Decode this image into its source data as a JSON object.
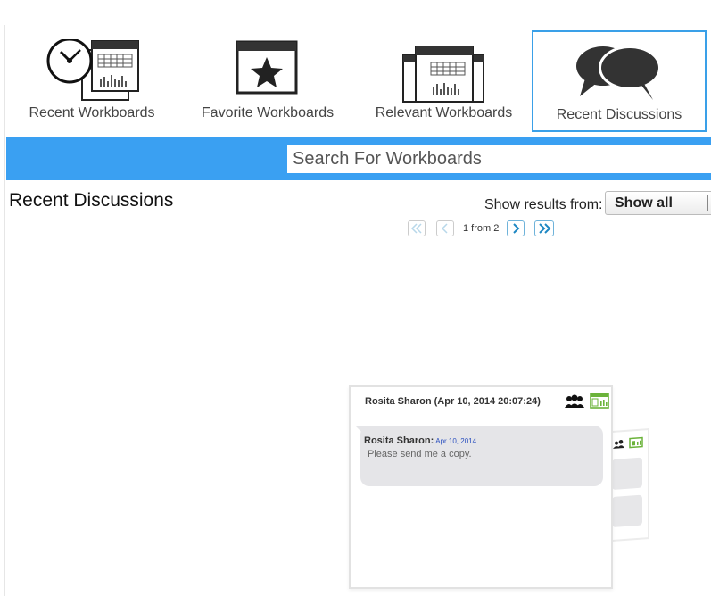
{
  "tabs": [
    {
      "label": "Recent Workboards",
      "icon": "clock-workboard-icon"
    },
    {
      "label": "Favorite Workboards",
      "icon": "star-workboard-icon"
    },
    {
      "label": "Relevant Workboards",
      "icon": "stacked-workboards-icon"
    },
    {
      "label": "Recent Discussions",
      "icon": "speech-bubbles-icon",
      "active": true
    }
  ],
  "search": {
    "placeholder": "Search For Workboards",
    "value": ""
  },
  "section": {
    "title": "Recent Discussions"
  },
  "filter": {
    "label": "Show results from:",
    "selected": "Show all"
  },
  "pager": {
    "info": "1 from 2"
  },
  "discussion": {
    "header": "Rosita Sharon (Apr 10, 2014  20:07:24)",
    "messages": [
      {
        "author": "Rosita Sharon:",
        "date": "Apr 10, 2014",
        "text": "Please send me a copy."
      }
    ]
  },
  "colors": {
    "accent": "#3aa0f2",
    "active_border": "#3aa0e8",
    "workboard_green": "#6bb33a",
    "date_link": "#2a4fbf"
  }
}
